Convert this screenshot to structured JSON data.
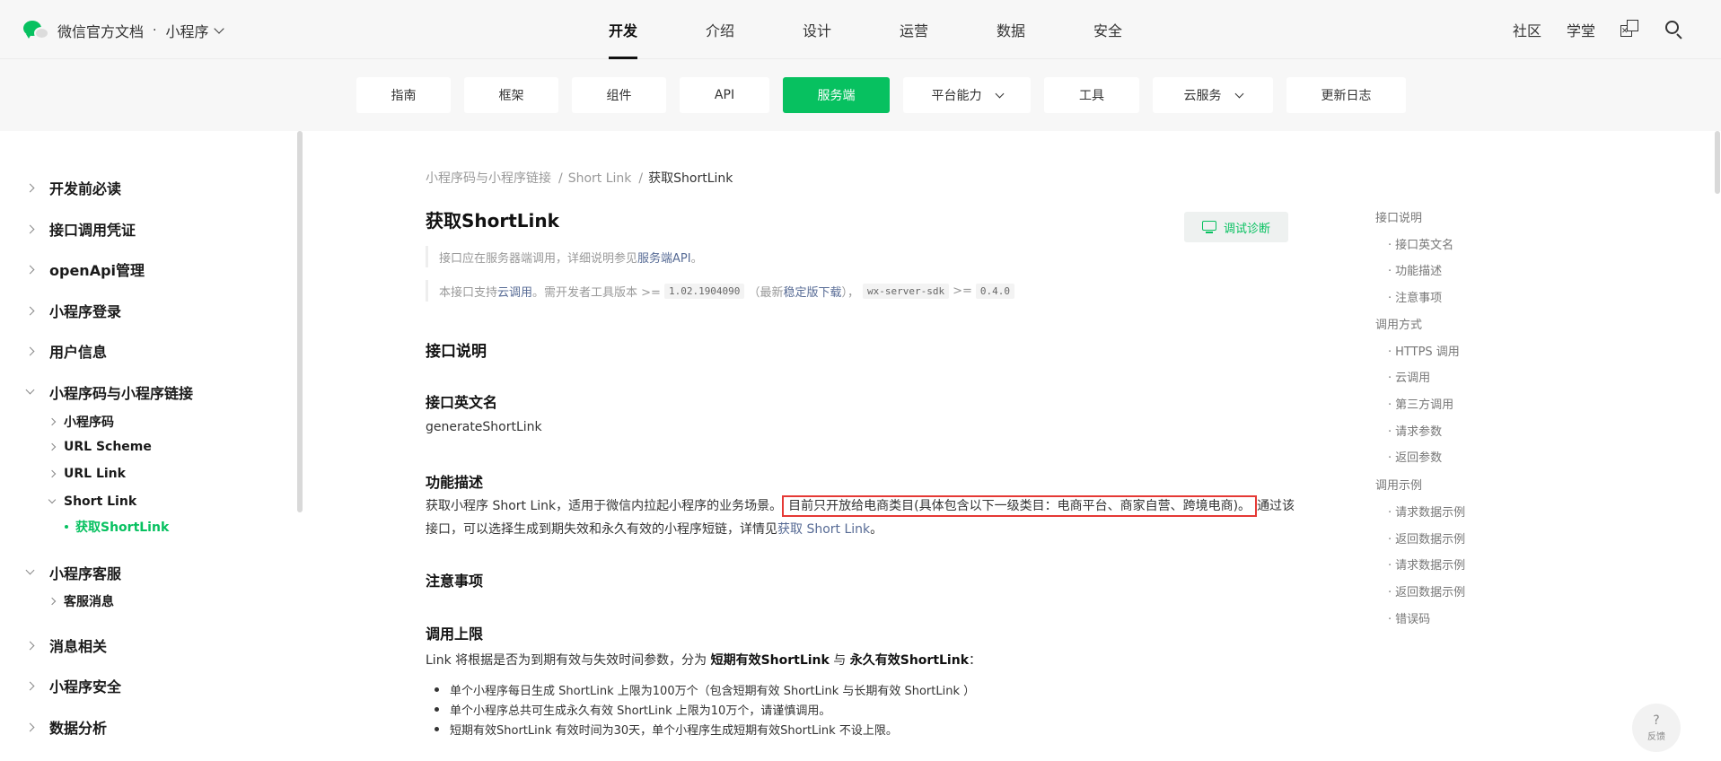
{
  "header": {
    "brand_title": "微信官方文档",
    "brand_dot": "·",
    "brand_product": "小程序",
    "main_nav": [
      "开发",
      "介绍",
      "设计",
      "运营",
      "数据",
      "安全"
    ],
    "active_main_nav": "开发",
    "right_links": [
      "社区",
      "学堂"
    ],
    "icons": [
      "qa-icon",
      "search-icon"
    ]
  },
  "subnav": {
    "tabs": [
      {
        "label": "指南"
      },
      {
        "label": "框架"
      },
      {
        "label": "组件"
      },
      {
        "label": "API"
      },
      {
        "label": "服务端"
      },
      {
        "label": "平台能力"
      },
      {
        "label": "工具"
      },
      {
        "label": "云服务"
      },
      {
        "label": "更新日志"
      }
    ],
    "active_tab": "服务端"
  },
  "sidebar": {
    "items": [
      {
        "label": "开发前必读"
      },
      {
        "label": "接口调用凭证"
      },
      {
        "label": "openApi管理"
      },
      {
        "label": "小程序登录"
      },
      {
        "label": "用户信息"
      },
      {
        "label": "小程序码与小程序链接"
      },
      {
        "label": "小程序码"
      },
      {
        "label": "URL Scheme"
      },
      {
        "label": "URL Link"
      },
      {
        "label": "Short Link"
      },
      {
        "label": "获取ShortLink"
      },
      {
        "label": "小程序客服"
      },
      {
        "label": "客服消息"
      },
      {
        "label": "消息相关"
      },
      {
        "label": "小程序安全"
      },
      {
        "label": "数据分析"
      }
    ]
  },
  "content": {
    "breadcrumb": [
      "小程序码与小程序链接",
      "Short Link",
      "获取ShortLink"
    ],
    "breadcrumb_sep": "/",
    "title": "获取ShortLink",
    "debug_button": "调试诊断",
    "tip1": {
      "text": "接口应在服务器端调用，详细说明参见",
      "link": "服务端API",
      "end": "。"
    },
    "tip2": {
      "t1": "本接口支持",
      "link1": "云调用",
      "t2": "。需开发者工具版本 >=",
      "code1": "1.02.1904090",
      "t3": "（最新",
      "link2": "稳定版下载",
      "t4": "），",
      "code2": "wx-server-sdk",
      "t5": ">=",
      "code3": "0.4.0"
    },
    "section_api_desc": "接口说明",
    "h_english_name": "接口英文名",
    "english_name": "generateShortLink",
    "h_function": "功能描述",
    "func_line1_a": "获取小程序 Short Link，适用于微信内拉起小程序的业务场景。",
    "func_highlight": "目前只开放给电商类目(具体包含以下一级类目：电商平台、商家自营、跨境电商)。",
    "func_line1_b": "通过该",
    "func_line2_a": "接口，可以选择生成到期失效和永久有效的小程序短链，详情见",
    "func_line2_link": "获取 Short Link",
    "func_line2_end": "。",
    "h_notes": "注意事项",
    "h_limit": "调用上限",
    "limit_a": "Link 将根据是否为到期有效与失效时间参数，分为 ",
    "limit_b1": "短期有效ShortLink",
    "limit_c": " 与 ",
    "limit_b2": "永久有效ShortLink",
    "limit_d": "：",
    "bullets": [
      "单个小程序每日生成 ShortLink 上限为100万个（包含短期有效 ShortLink 与长期有效 ShortLink ）",
      "单个小程序总共可生成永久有效 ShortLink 上限为10万个，请谨慎调用。",
      "短期有效ShortLink 有效时间为30天，单个小程序生成短期有效ShortLink 不设上限。"
    ]
  },
  "toc": {
    "entries": [
      {
        "label": "接口说明"
      },
      {
        "label": "接口英文名"
      },
      {
        "label": "功能描述"
      },
      {
        "label": "注意事项"
      },
      {
        "label": "调用方式"
      },
      {
        "label": "HTTPS 调用"
      },
      {
        "label": "云调用"
      },
      {
        "label": "第三方调用"
      },
      {
        "label": "请求参数"
      },
      {
        "label": "返回参数"
      },
      {
        "label": "调用示例"
      },
      {
        "label": "请求数据示例"
      },
      {
        "label": "返回数据示例"
      },
      {
        "label": "请求数据示例"
      },
      {
        "label": "返回数据示例"
      },
      {
        "label": "错误码"
      }
    ]
  },
  "feedback": {
    "icon": "?",
    "label": "反馈"
  },
  "colors": {
    "accent": "#07c160",
    "link": "#576b95",
    "highlight_border": "#e53935"
  }
}
